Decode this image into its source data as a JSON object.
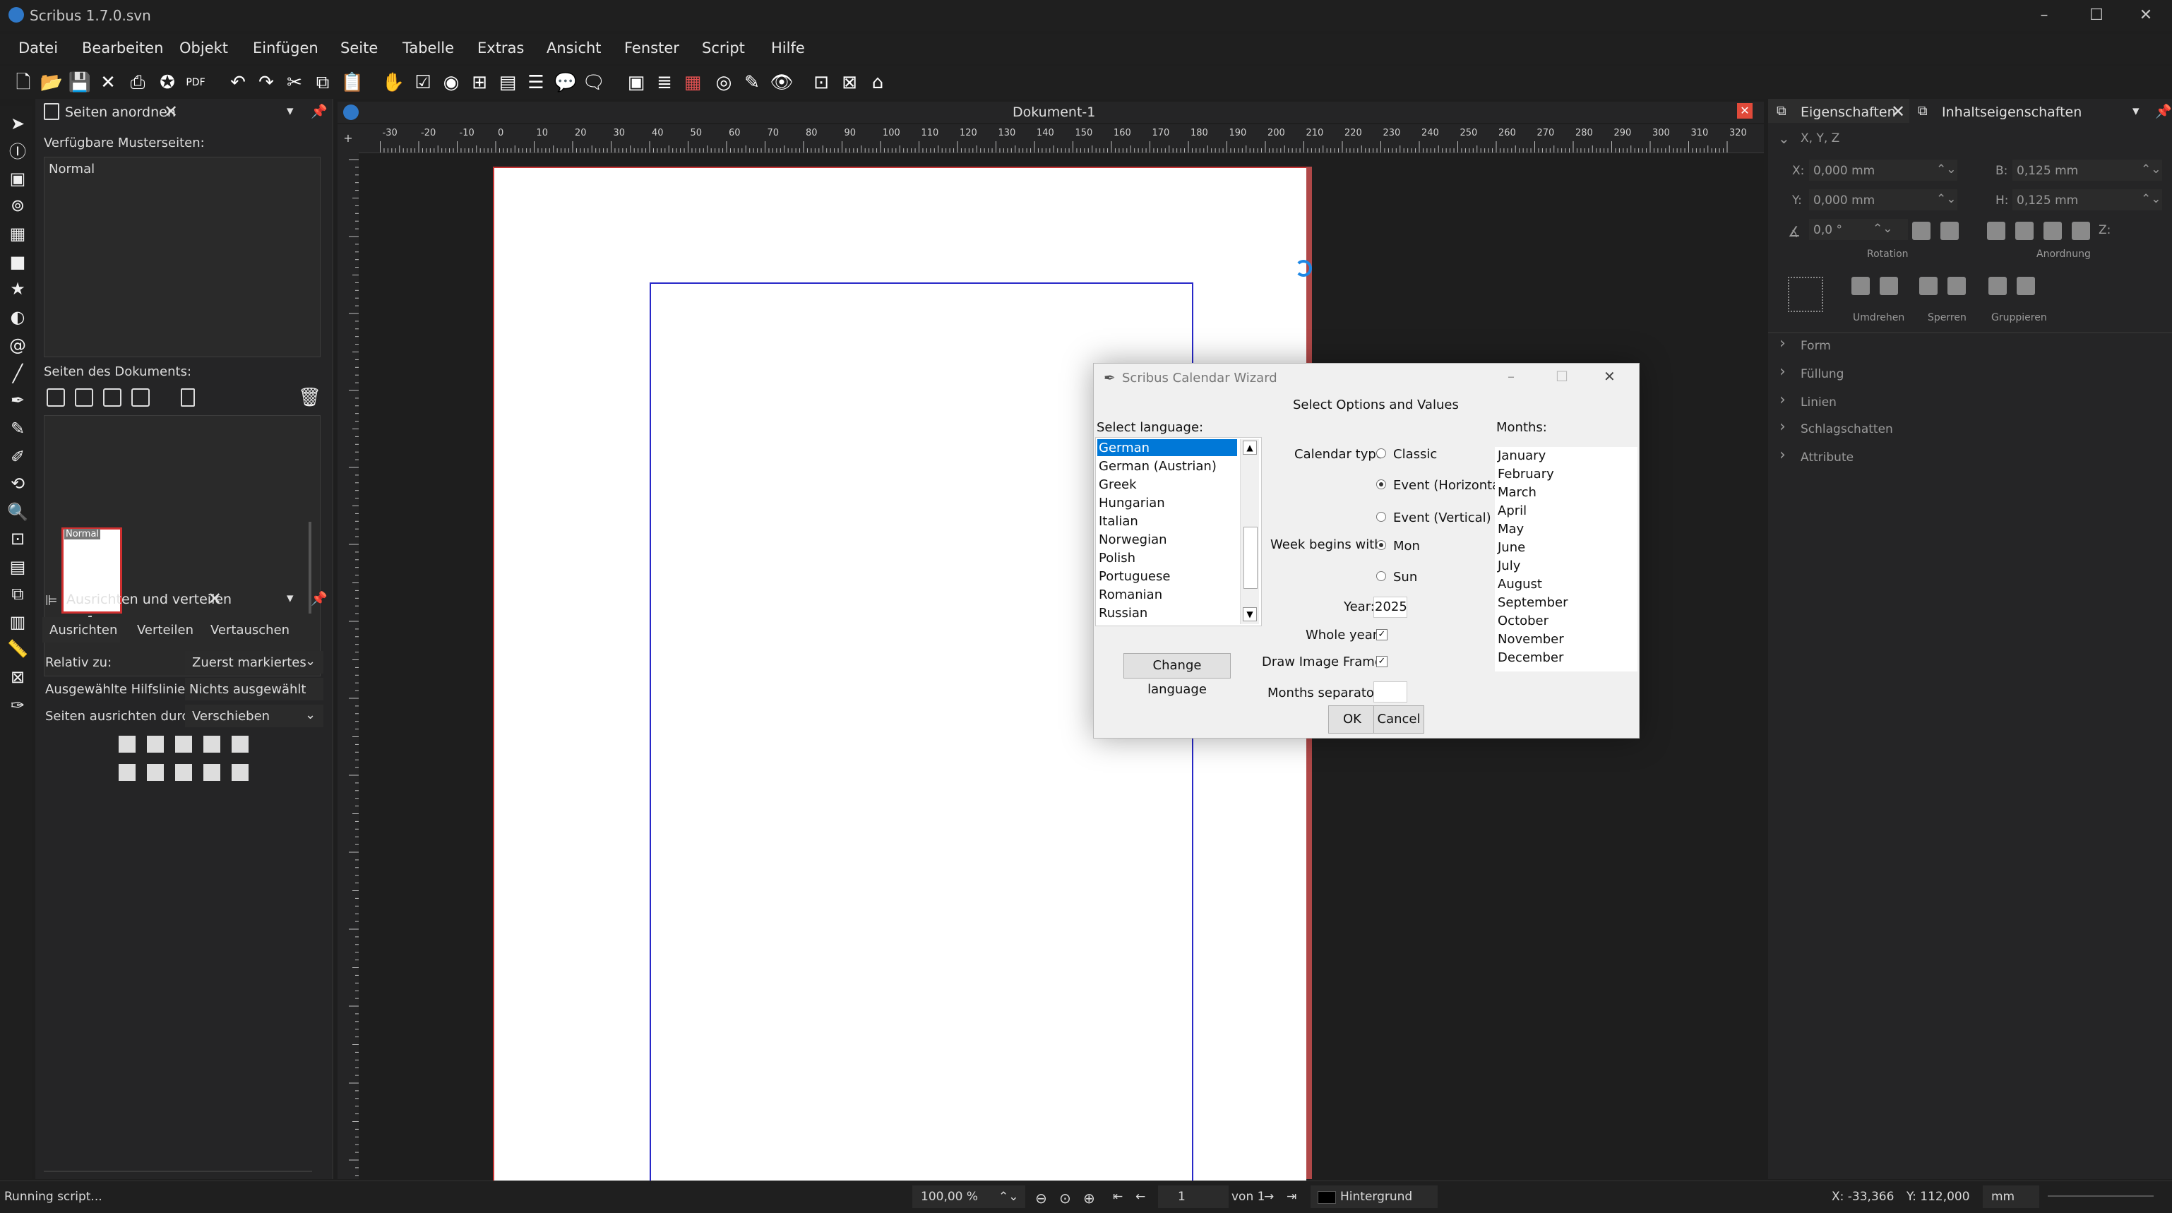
{
  "window": {
    "title": "Scribus 1.7.0.svn"
  },
  "menu": [
    "Datei",
    "Bearbeiten",
    "Objekt",
    "Einfügen",
    "Seite",
    "Tabelle",
    "Extras",
    "Ansicht",
    "Fenster",
    "Script",
    "Hilfe"
  ],
  "left_panel": {
    "tab_title": "Seiten anordnen",
    "master_label": "Verfügbare Musterseiten:",
    "master_item": "Normal",
    "doc_pages_label": "Seiten des Dokuments:",
    "thumb_label": "Normal",
    "page_number": "1"
  },
  "align_panel": {
    "title": "Ausrichten und verteilen",
    "tabs": [
      "Ausrichten",
      "Verteilen",
      "Vertauschen"
    ],
    "relativ_label": "Relativ zu:",
    "relativ_value": "Zuerst markiertes",
    "guide_label": "Ausgewählte Hilfslinie:",
    "guide_value": "Nichts ausgewählt",
    "align_by_label": "Seiten ausrichten durch:",
    "align_by_value": "Verschieben"
  },
  "document": {
    "title": "Dokument-1"
  },
  "ruler_labels": [
    "-30",
    "-20",
    "-10",
    "0",
    "10",
    "20",
    "30",
    "40",
    "50",
    "60",
    "70",
    "80",
    "90",
    "100",
    "110",
    "120",
    "130",
    "140",
    "150",
    "160",
    "170",
    "180",
    "190",
    "200",
    "210",
    "220",
    "230",
    "240",
    "250",
    "260",
    "270",
    "280",
    "290",
    "300",
    "310",
    "320"
  ],
  "right_panel": {
    "tab1": "Eigenschaften",
    "tab2": "Inhaltseigenschaften",
    "xyz": "X, Y, Z",
    "x_label": "X:",
    "x_value": "0,000 mm",
    "y_label": "Y:",
    "y_value": "0,000 mm",
    "b_label": "B:",
    "b_value": "0,125 mm",
    "h_label": "H:",
    "h_value": "0,125 mm",
    "rot_value": "0,0 °",
    "z_label": "Z:",
    "rotation_label": "Rotation",
    "anordnung_label": "Anordnung",
    "umdrehen_label": "Umdrehen",
    "sperren_label": "Sperren",
    "gruppieren_label": "Gruppieren",
    "sections": [
      "Form",
      "Füllung",
      "Linien",
      "Schlagschatten",
      "Attribute"
    ]
  },
  "dialog": {
    "title": "Scribus Calendar Wizard",
    "select_language_label": "Select language:",
    "languages": [
      "German",
      "German (Austrian)",
      "Greek",
      "Hungarian",
      "Italian",
      "Norwegian",
      "Polish",
      "Portuguese",
      "Romanian",
      "Russian"
    ],
    "selected_language": "German",
    "change_language": "Change language",
    "header": "Select Options and Values",
    "calendar_type_label": "Calendar type",
    "calendar_types": [
      "Classic",
      "Event (Horizontal)",
      "Event (Vertical)"
    ],
    "selected_calendar_type": "Event (Horizontal)",
    "week_begins_label": "Week begins with:",
    "week_options": [
      "Mon",
      "Sun"
    ],
    "selected_week": "Mon",
    "year_label": "Year:",
    "year_value": "2025",
    "whole_year_label": "Whole year:",
    "draw_frame_label": "Draw Image Frame:",
    "months_sep_label": "Months separator:",
    "ok": "OK",
    "cancel": "Cancel",
    "months_label": "Months:",
    "months": [
      "January",
      "February",
      "March",
      "April",
      "May",
      "June",
      "July",
      "August",
      "September",
      "October",
      "November",
      "December"
    ]
  },
  "status": {
    "message": "Running script...",
    "zoom": "100,00 %",
    "page": "1",
    "page_of": "von 1",
    "layer": "Hintergrund",
    "x_readout": "X: -33,366",
    "y_readout": "Y: 112,000",
    "unit": "mm"
  },
  "colors": {
    "accent": "#0078d7",
    "page_border": "#c43232",
    "margin": "#2828c8"
  }
}
